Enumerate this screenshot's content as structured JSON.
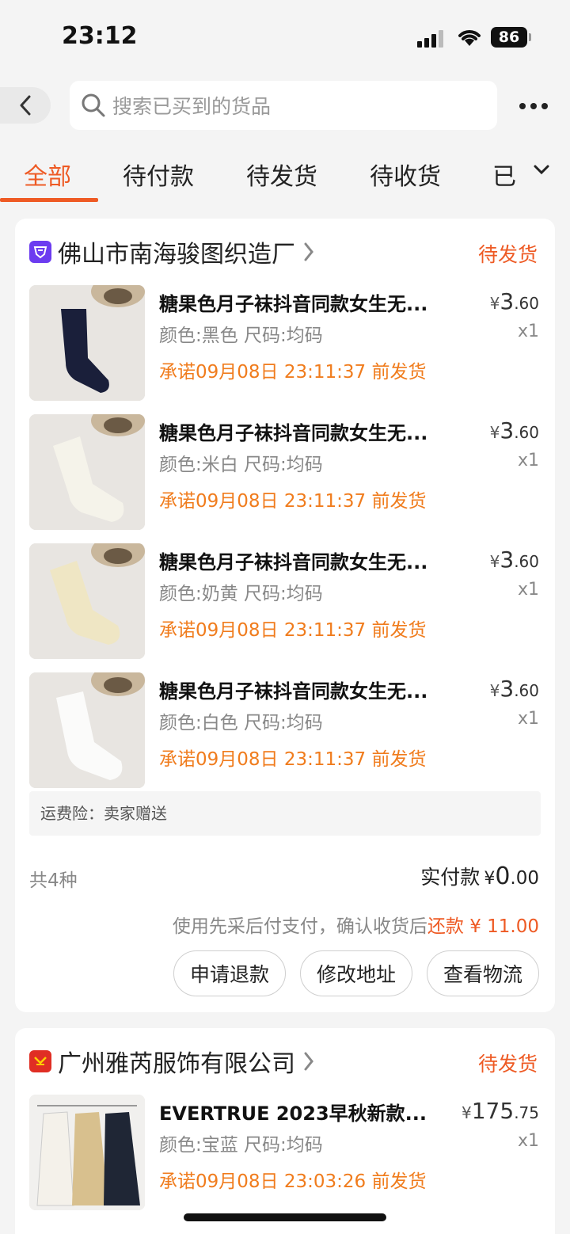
{
  "status_bar": {
    "time": "23:12",
    "battery": "86"
  },
  "search": {
    "placeholder": "搜索已买到的货品"
  },
  "tabs": [
    {
      "label": "全部",
      "active": true
    },
    {
      "label": "待付款"
    },
    {
      "label": "待发货"
    },
    {
      "label": "待收货"
    },
    {
      "label": "已"
    }
  ],
  "orders": [
    {
      "shop_name": "佛山市南海骏图织造厂",
      "status": "待发货",
      "items": [
        {
          "title": "糖果色月子袜抖音同款女生无...",
          "spec": "颜色:黑色 尺码:均码",
          "promise": "承诺09月08日 23:11:37 前发货",
          "price_currency": "¥",
          "price_int": "3",
          "price_dec": ".60",
          "qty": "x1"
        },
        {
          "title": "糖果色月子袜抖音同款女生无...",
          "spec": "颜色:米白 尺码:均码",
          "promise": "承诺09月08日 23:11:37 前发货",
          "price_currency": "¥",
          "price_int": "3",
          "price_dec": ".60",
          "qty": "x1"
        },
        {
          "title": "糖果色月子袜抖音同款女生无...",
          "spec": "颜色:奶黄 尺码:均码",
          "promise": "承诺09月08日 23:11:37 前发货",
          "price_currency": "¥",
          "price_int": "3",
          "price_dec": ".60",
          "qty": "x1"
        },
        {
          "title": "糖果色月子袜抖音同款女生无...",
          "spec": "颜色:白色 尺码:均码",
          "promise": "承诺09月08日 23:11:37 前发货",
          "price_currency": "¥",
          "price_int": "3",
          "price_dec": ".60",
          "qty": "x1"
        }
      ],
      "insurance": "运费险：卖家赠送",
      "count": "共4种",
      "paid_label": "实付款",
      "paid_currency": "¥",
      "paid_int": "0",
      "paid_dec": ".00",
      "note_prefix": "使用先采后付支付，确认收货后",
      "note_highlight": "还款 ¥ 11.00",
      "actions": [
        "申请退款",
        "修改地址",
        "查看物流"
      ]
    },
    {
      "shop_name": "广州雅芮服饰有限公司",
      "status": "待发货",
      "items": [
        {
          "title": "EVERTRUE 2023早秋新款...",
          "spec": "颜色:宝蓝 尺码:均码",
          "promise": "承诺09月08日 23:03:26 前发货",
          "price_currency": "¥",
          "price_int": "175",
          "price_dec": ".75",
          "qty": "x1"
        }
      ]
    }
  ],
  "colors": {
    "accent": "#ee5a24",
    "promise": "#f07c1d",
    "muted": "#888888"
  }
}
